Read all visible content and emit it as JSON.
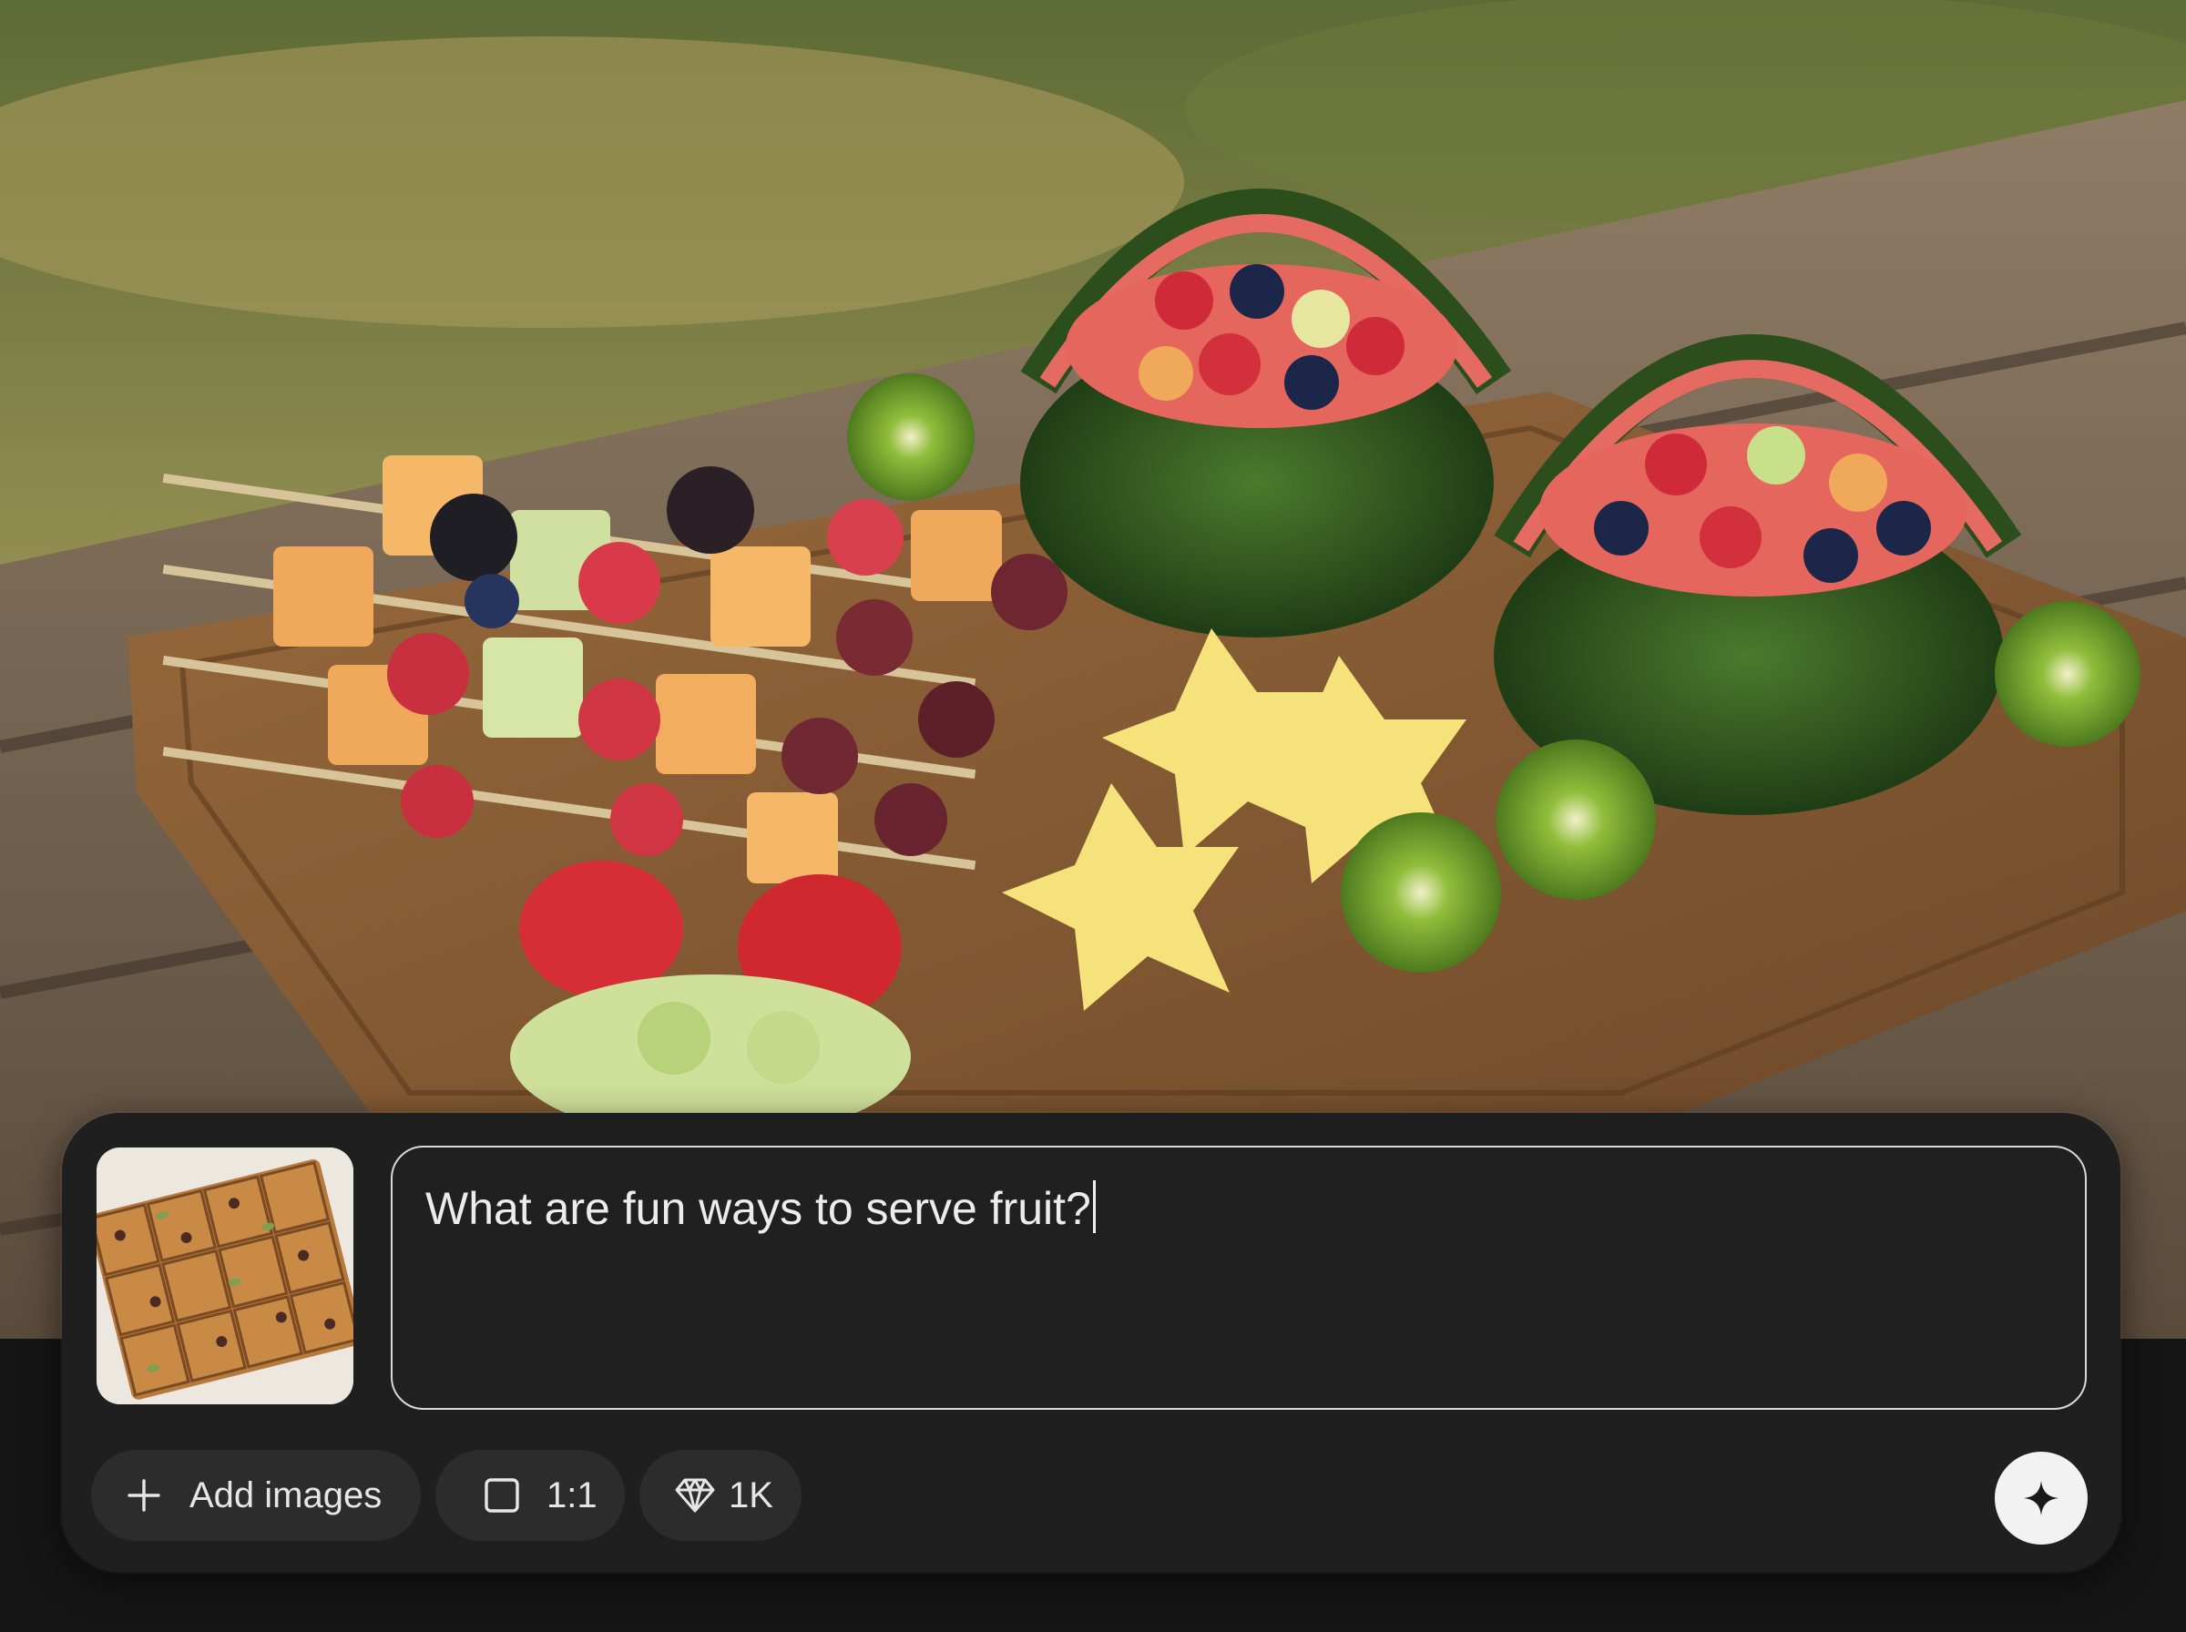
{
  "prompt": {
    "value": "What are fun ways to serve fruit?"
  },
  "toolbar": {
    "add_images_label": "Add images",
    "aspect_ratio_label": "1:1",
    "resolution_label": "1K"
  },
  "icons": {
    "add": "plus-icon",
    "aspect_ratio": "square-icon",
    "resolution": "diamond-icon",
    "send": "sparkle-icon"
  },
  "colors": {
    "panel": "#1f1f1f",
    "chip": "#2c2c2c",
    "send_button": "#f2f2f2",
    "text": "#ececec"
  }
}
